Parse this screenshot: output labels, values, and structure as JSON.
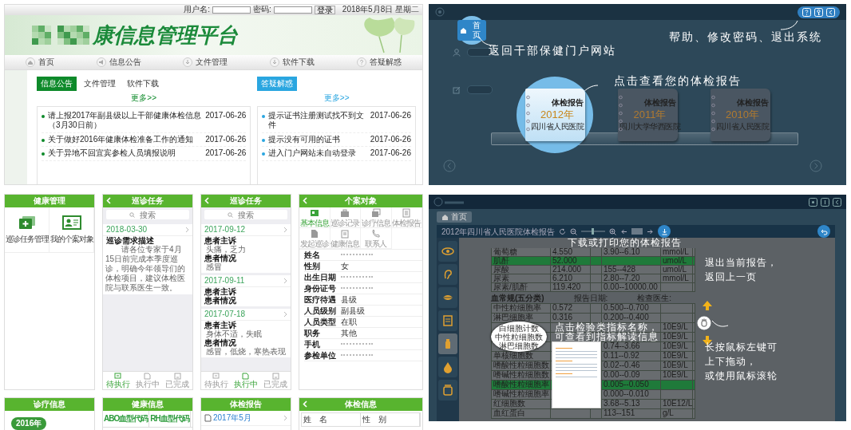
{
  "portal": {
    "login": {
      "username_label": "用户名:",
      "password_label": "密码:",
      "button": "登录",
      "date": "2018年5月8日 星期二"
    },
    "title": "康信息管理平台",
    "nav": [
      {
        "label": "首页"
      },
      {
        "label": "信息公告"
      },
      {
        "label": "文件管理"
      },
      {
        "label": "软件下载"
      },
      {
        "label": "答疑解惑"
      }
    ],
    "panels": [
      {
        "color": "#0e8a2a",
        "tabs": [
          {
            "label": "信息公告",
            "selected": true
          },
          {
            "label": "文件管理",
            "selected": false
          },
          {
            "label": "软件下载",
            "selected": false
          }
        ],
        "more": "更多>>",
        "items": [
          {
            "title": "请上报2017年副县级以上干部健康体检信息（3月30日前）",
            "date": "2017-06-26"
          },
          {
            "title": "关于做好2016年健康体检准备工作的通知",
            "date": "2017-06-26"
          },
          {
            "title": "关于异地不回宜宾参检人员填报说明",
            "date": "2017-06-26"
          }
        ]
      },
      {
        "color": "#2aa6e0",
        "tabs": [
          {
            "label": "答疑解惑",
            "selected": true
          }
        ],
        "more": "更多>>",
        "items": [
          {
            "title": "提示证书注册测试找不到文件",
            "date": "2017-06-26"
          },
          {
            "title": "提示没有可用的证书",
            "date": "2017-06-26"
          },
          {
            "title": "进入门户网站未自动登录",
            "date": "2017-06-26"
          }
        ]
      }
    ]
  },
  "report_shelf": {
    "home_button": "首页",
    "annotations": [
      {
        "text": "返回干部保健门户网站"
      },
      {
        "text": "帮助、修改密码、退出系统"
      },
      {
        "text": "点击查看您的体检报告"
      }
    ],
    "books": [
      {
        "label": "体检报告",
        "year": "2012年",
        "hospital": "四川省人民医院",
        "selected": true
      },
      {
        "label": "体检报告",
        "year": "2011年",
        "hospital": "四川大学华西医院",
        "selected": false
      },
      {
        "label": "体检报告",
        "year": "2010年",
        "hospital": "四川省人民医院",
        "selected": false
      }
    ]
  },
  "mobile": {
    "health_menu": {
      "title": "健康管理",
      "back": false,
      "tiles": [
        {
          "label": "巡诊任务管理"
        },
        {
          "label": "我的个案对象"
        }
      ]
    },
    "task_lists": [
      {
        "title": "巡诊任务",
        "back": true,
        "search_placeholder": "搜索",
        "tasks": [
          {
            "date": "2018-03-30",
            "fields": [
              {
                "label": "巡诊需求描述",
                "value": "请各位专家于4月15日前完成本季度巡诊，明确今年领导们的体检项目，建议体检医院与联系医生一致。"
              }
            ]
          }
        ],
        "tabs": [
          {
            "label": "待执行",
            "selected": true
          },
          {
            "label": "执行中",
            "selected": false
          },
          {
            "label": "已完成",
            "selected": false
          }
        ]
      },
      {
        "title": "巡诊任务",
        "back": true,
        "search_placeholder": "搜索",
        "tasks": [
          {
            "date": "2017-09-12",
            "fields": [
              {
                "label": "患者主诉",
                "value": "头痛，乏力"
              },
              {
                "label": "患者情况",
                "value": "感冒"
              }
            ]
          },
          {
            "date": "2017-09-11",
            "fields": [
              {
                "label": "患者主诉"
              },
              {
                "label": "患者情况"
              }
            ]
          },
          {
            "date": "2017-07-18",
            "fields": [
              {
                "label": "患者主诉",
                "value": "身体不适，失眠"
              },
              {
                "label": "患者情况",
                "value": "感冒，低烧，寒热表现"
              }
            ]
          }
        ],
        "tabs": [
          {
            "label": "待执行",
            "selected": false
          },
          {
            "label": "执行中",
            "selected": true
          },
          {
            "label": "已完成",
            "selected": false
          }
        ]
      }
    ],
    "profile": {
      "title": "个案对象",
      "back": true,
      "sections": [
        {
          "label": "基本信息",
          "selected": true
        },
        {
          "label": "巡诊记录",
          "selected": false
        },
        {
          "label": "诊疗信息",
          "selected": false
        },
        {
          "label": "体检报告",
          "selected": false
        },
        {
          "label": "发起巡诊",
          "selected": false
        },
        {
          "label": "健康信息",
          "selected": false
        },
        {
          "label": "联系人",
          "selected": false
        }
      ],
      "fields": [
        {
          "label": "姓名",
          "masked": true
        },
        {
          "label": "性别",
          "value": "女",
          "masked": false
        },
        {
          "label": "出生日期",
          "masked": true
        },
        {
          "label": "身份证号",
          "masked": true
        },
        {
          "label": "医疗待遇",
          "value": "县级",
          "masked": false
        },
        {
          "label": "人员级别",
          "value": "副县级",
          "masked": false
        },
        {
          "label": "人员类型",
          "value": "在职",
          "masked": false
        },
        {
          "label": "职务",
          "value": "其他",
          "masked": false
        },
        {
          "label": "手机",
          "masked": true
        },
        {
          "label": "参检单位",
          "masked": true
        }
      ]
    },
    "lower_screens": [
      {
        "title": "诊疗信息",
        "back": false,
        "kind": "years",
        "entries": [
          "2016年"
        ]
      },
      {
        "title": "健康信息",
        "back": false,
        "kind": "cells",
        "entries": [
          "ABO血型代码",
          "RH血型代码"
        ]
      },
      {
        "title": "体检报告",
        "back": false,
        "kind": "files",
        "entries": [
          "2017年5月"
        ]
      },
      {
        "title": "体检信息",
        "back": true,
        "kind": "form",
        "entries": [
          "姓　名",
          "性　别"
        ]
      }
    ]
  },
  "report_viewer": {
    "home_button": "首页",
    "document_title": "2012年四川省人民医院体检报告",
    "zoom_slider": {
      "level": 0.45
    },
    "sidebar": [
      {
        "selected": false
      },
      {
        "selected": false
      },
      {
        "selected": false
      },
      {
        "selected": false
      },
      {
        "selected": true
      },
      {
        "selected": false
      },
      {
        "selected": false
      }
    ],
    "rows": [
      {
        "name": "葡萄糖",
        "result": "4.550",
        "range": "3.90--6.10",
        "unit": "mmol/L",
        "highlight": false
      },
      {
        "name": "肌酐",
        "result": "52.000",
        "unit": "umol/L",
        "highlight": true
      },
      {
        "name": "尿酸",
        "result": "214.000",
        "range": "155--428",
        "unit": "umol/L",
        "highlight": false
      },
      {
        "name": "尿素",
        "result": "6.210",
        "range": "2.80--7.20",
        "unit": "mmol/L",
        "highlight": false
      },
      {
        "name": "尿素/肌酐",
        "result": "119.420",
        "range": "0.00--10000.00",
        "highlight": false
      }
    ],
    "section": {
      "title": "血常规(五分类)",
      "date_label": "报告日期:",
      "doctor_label": "检查医生:"
    },
    "section_rows": [
      {
        "name": "中性粒细胞率",
        "result": "0.572",
        "range": "0.500--0.700",
        "highlight": false
      },
      {
        "name": "淋巴细胞率",
        "result": "0.316",
        "range": "0.200--0.400",
        "highlight": false
      },
      {
        "unit": "10E9/L",
        "highlight": false
      },
      {
        "unit": "10E9/L",
        "highlight": false
      },
      {
        "range": "0.74--3.66",
        "unit": "10E9/L",
        "highlight": false
      },
      {
        "name": "单核细胞数",
        "range": "0.11--0.92",
        "unit": "10E9/L",
        "highlight": false
      },
      {
        "name": "嗜酸性粒细胞数",
        "range": "0.02--0.46",
        "unit": "10E9/L",
        "highlight": false
      },
      {
        "name": "嗜碱性粒细胞数",
        "range": "0.00--0.09",
        "unit": "10E9/L",
        "highlight": false
      },
      {
        "name": "嗜酸性粒细胞率",
        "range": "0.005--0.050",
        "highlight": true
      },
      {
        "name": "嗜碱性粒细胞率",
        "range": "0.000--0.010",
        "highlight": false
      },
      {
        "name": "红细胞数",
        "range": "3.68--5.13",
        "unit": "10E12/L",
        "highlight": false
      },
      {
        "name": "血红蛋白",
        "range": "113--151",
        "unit": "g/L",
        "highlight": false
      }
    ],
    "magnifier": [
      "白细胞计数",
      "中性粒细胞数",
      "淋巴细胞数"
    ],
    "annotations": [
      {
        "lines": [
          "下载或打印您的体检报告"
        ]
      },
      {
        "lines": [
          "退出当前报告，",
          "返回上一页"
        ]
      },
      {
        "lines": [
          "点击检验类指标名称，",
          "可查看到指标解读信息"
        ]
      },
      {
        "lines": [
          "长按鼠标左键可",
          "上下拖动，",
          "或使用鼠标滚轮"
        ]
      }
    ]
  }
}
